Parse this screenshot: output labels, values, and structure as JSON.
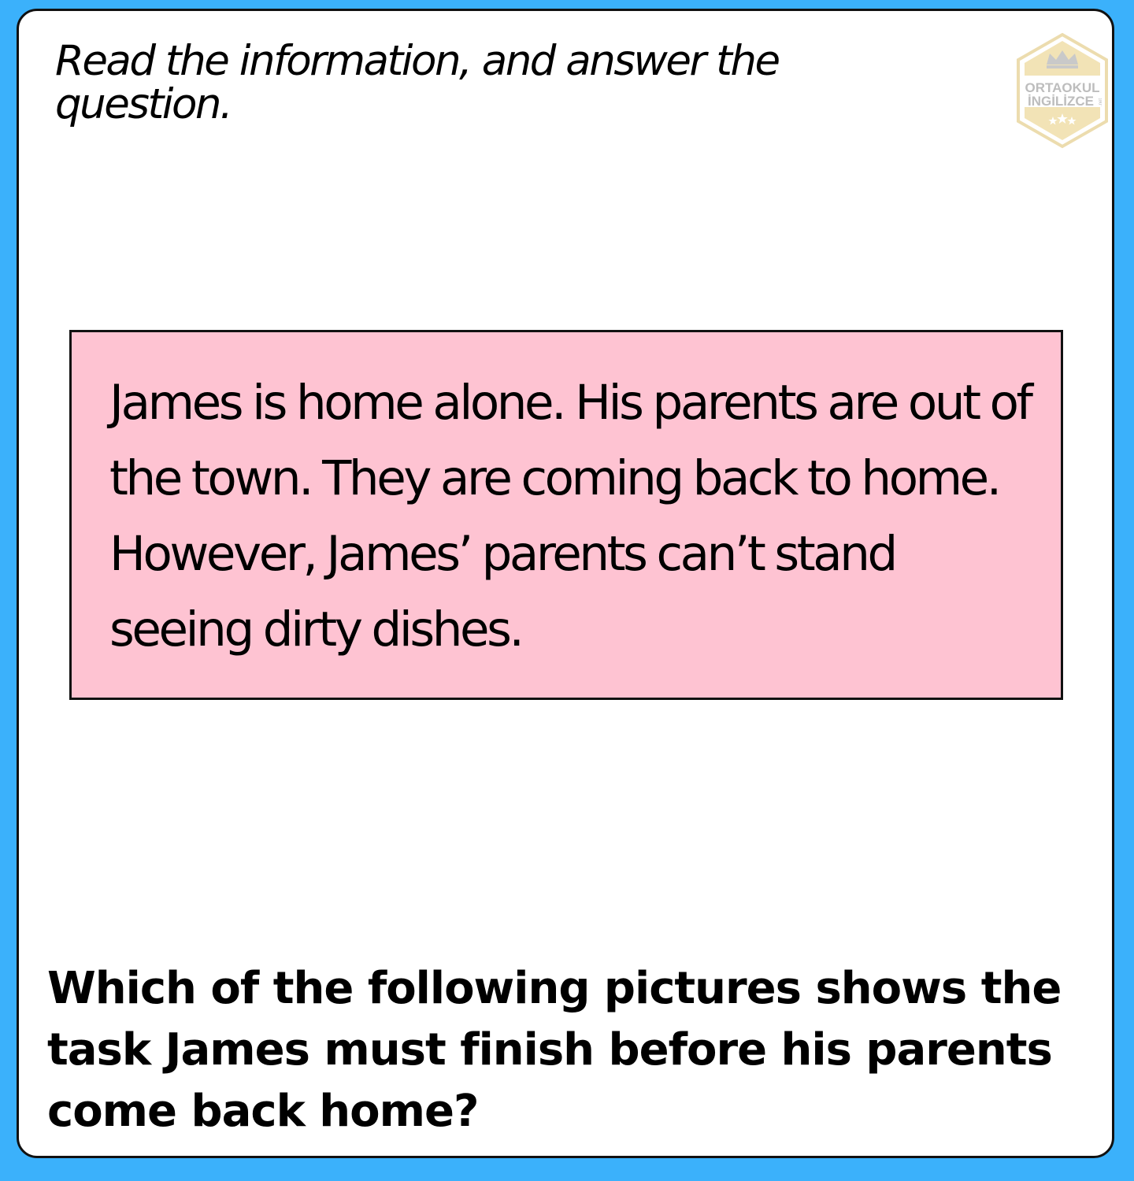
{
  "instruction": "Read the information, and answer the question.",
  "logo": {
    "line1": "ORTAOKUL",
    "line2": "İNGİLİZCE",
    "suffix": ".net",
    "icon": "crown-icon",
    "colors": {
      "gold": "#e9c96a",
      "gray": "#c9c9c9"
    }
  },
  "info_box": {
    "text": "James is home alone. His parents are out of the town. They are coming back to home. However, James’ parents can’t stand seeing dirty dishes.",
    "background": "#fec3d2"
  },
  "question": "Which of the following pictures shows the task James must finish before his parents come back home?",
  "colors": {
    "page_background": "#3bb1fb",
    "card_background": "#ffffff",
    "border": "#111111"
  }
}
